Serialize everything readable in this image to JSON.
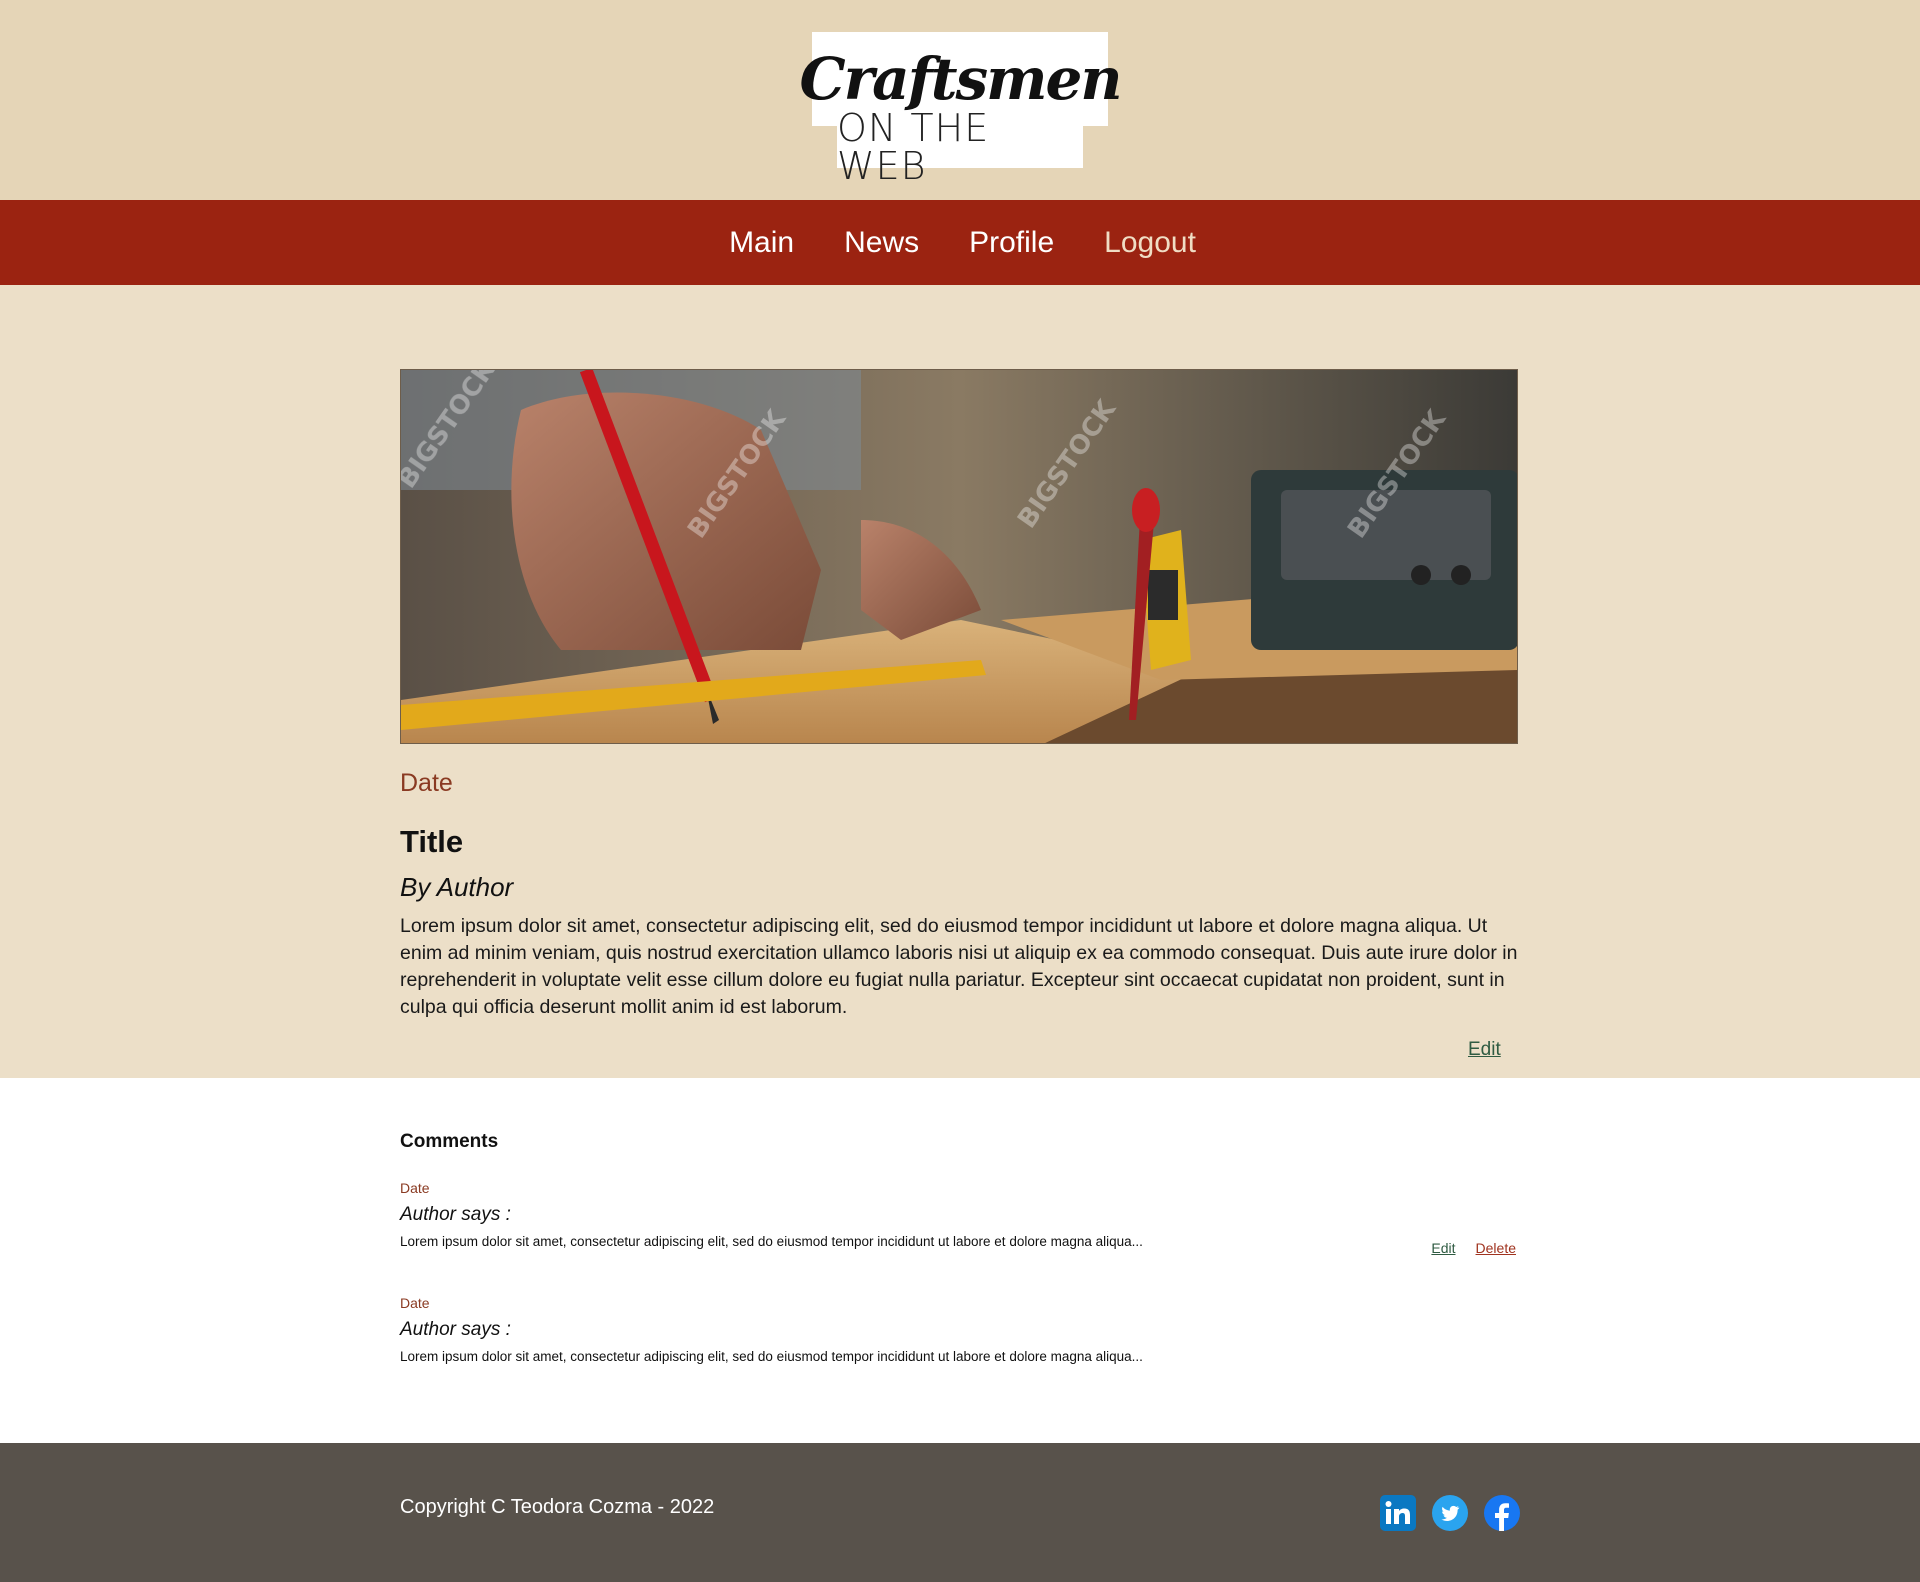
{
  "logo": {
    "script": "Craftsmen",
    "subtitle": "ON THE WEB"
  },
  "nav": {
    "items": [
      {
        "label": "Main"
      },
      {
        "label": "News"
      },
      {
        "label": "Profile"
      },
      {
        "label": "Logout"
      }
    ]
  },
  "article": {
    "image_watermark": "BIGSTOCK",
    "date": "Date",
    "title": "Title",
    "author": "By Author",
    "body": "Lorem ipsum dolor sit amet, consectetur adipiscing elit, sed do eiusmod tempor incididunt ut labore et dolore magna aliqua. Ut enim ad minim veniam, quis nostrud exercitation ullamco laboris nisi ut aliquip ex ea commodo consequat. Duis aute irure dolor in reprehenderit in voluptate velit esse cillum dolore eu fugiat nulla pariatur. Excepteur sint occaecat cupidatat non proident, sunt in culpa qui officia deserunt mollit anim id est laborum.",
    "edit_label": "Edit"
  },
  "comments": {
    "heading": "Comments",
    "items": [
      {
        "date": "Date",
        "author": "Author says :",
        "text": "Lorem ipsum dolor sit amet, consectetur adipiscing elit, sed do eiusmod tempor incididunt ut labore et dolore magna aliqua...",
        "edit_label": "Edit",
        "delete_label": "Delete"
      },
      {
        "date": "Date",
        "author": "Author says :",
        "text": "Lorem ipsum dolor sit amet, consectetur adipiscing elit, sed do eiusmod tempor incididunt ut labore et dolore magna aliqua..."
      }
    ]
  },
  "footer": {
    "copyright": "Copyright C Teodora Cozma - 2022",
    "socials": [
      {
        "icon": "linkedin-icon",
        "color": "#0a78c2"
      },
      {
        "icon": "twitter-icon",
        "color": "#2aa4ef"
      },
      {
        "icon": "facebook-icon",
        "color": "#1877f2"
      }
    ]
  },
  "colors": {
    "header_bg": "#e5d5b7",
    "nav_bg": "#9b2311",
    "article_bg": "#ecdfc8",
    "footer_bg": "#58524b",
    "accent_date": "#8a3a22"
  }
}
